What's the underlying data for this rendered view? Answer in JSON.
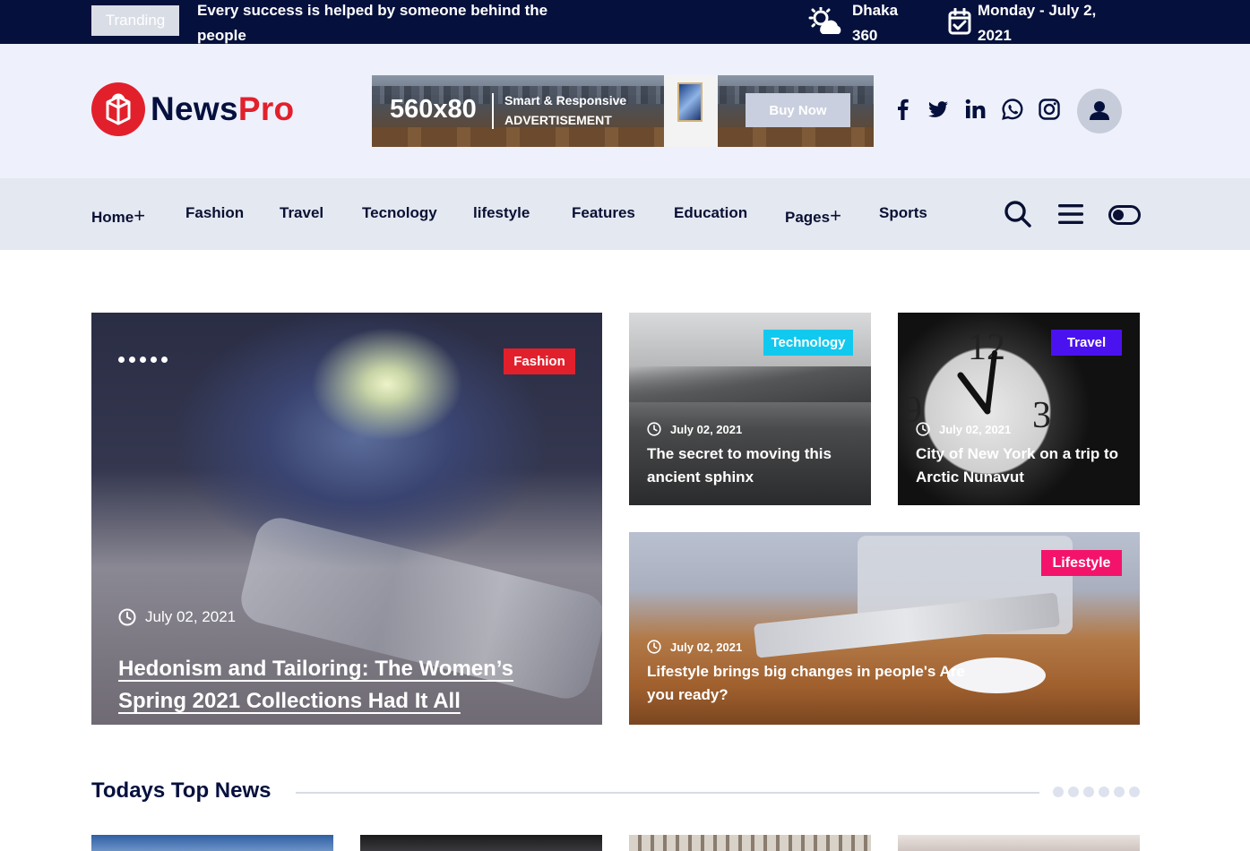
{
  "topbar": {
    "trending_label": "Tranding",
    "trending_text": "Every success is helped by someone behind the people",
    "weather_city": "Dhaka",
    "weather_value": "360",
    "date": "Monday - July 2, 2021"
  },
  "header": {
    "logo_part1": "News",
    "logo_part2": "Pro",
    "ad": {
      "size": "560x80",
      "line1": "Smart & Responsive",
      "line2": "ADVERTISEMENT",
      "button": "Buy Now"
    },
    "social_icons": [
      "facebook-icon",
      "twitter-icon",
      "linkedin-icon",
      "whatsapp-icon",
      "instagram-icon"
    ]
  },
  "nav": {
    "items": [
      "Home",
      "Fashion",
      "Travel",
      "Tecnology",
      "lifestyle",
      "Features",
      "Education",
      "Pages",
      "Sports"
    ],
    "plus": "+"
  },
  "featured": {
    "main": {
      "category": "Fashion",
      "date": "July 02, 2021",
      "title": "Hedonism and Tailoring: The Women’s Spring 2021 Collections Had It All"
    },
    "card2": {
      "category": "Technology",
      "date": "July 02, 2021",
      "title": "The secret to moving this ancient sphinx"
    },
    "card3": {
      "category": "Travel",
      "date": "July 02, 2021",
      "title": "City of New York on a trip to Arctic Nunavut"
    },
    "card4": {
      "category": "Lifestyle",
      "date": "July 02, 2021",
      "title": "Lifestyle brings big changes in people's Are you ready?"
    }
  },
  "colors": {
    "fashion": "#e2202c",
    "technology": "#11c9ef",
    "travel": "#4b12f0",
    "lifestyle": "#f4136b",
    "navy": "#05103d"
  },
  "section": {
    "title": "Todays Top News"
  }
}
